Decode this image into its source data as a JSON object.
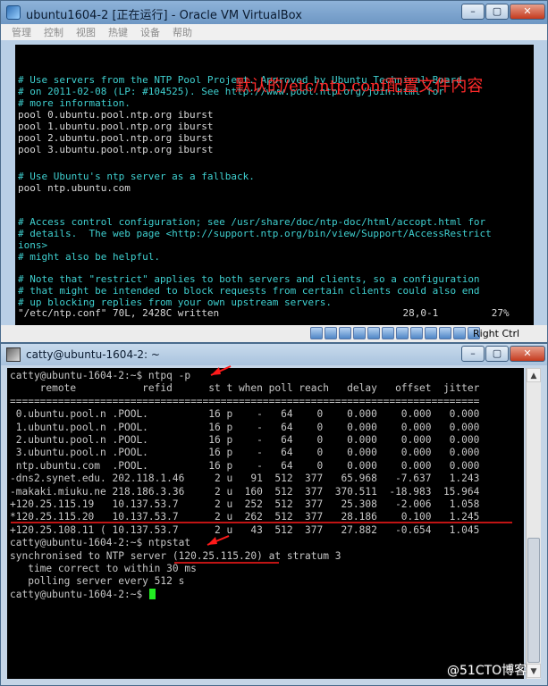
{
  "vbox": {
    "title": "ubuntu1604-2 [正在运行] - Oracle VM VirtualBox",
    "menu": [
      "管理",
      "控制",
      "视图",
      "热键",
      "设备",
      "帮助"
    ],
    "host_key": "Right Ctrl",
    "annotation": "默认的/etc/ntp.conf配置文件内容",
    "terminal_lines": [
      {
        "text": "# Use servers from the NTP Pool Project. Approved by Ubuntu Technical Board",
        "color": "cyan"
      },
      {
        "text": "# on 2011-02-08 (LP: #104525). See http://www.pool.ntp.org/join.html for",
        "color": "cyan"
      },
      {
        "text": "# more information.",
        "color": "cyan"
      },
      {
        "text": "pool 0.ubuntu.pool.ntp.org iburst",
        "color": "white"
      },
      {
        "text": "pool 1.ubuntu.pool.ntp.org iburst",
        "color": "white"
      },
      {
        "text": "pool 2.ubuntu.pool.ntp.org iburst",
        "color": "white"
      },
      {
        "text": "pool 3.ubuntu.pool.ntp.org iburst",
        "color": "white"
      },
      {
        "text": "",
        "color": "white"
      },
      {
        "text": "# Use Ubuntu's ntp server as a fallback.",
        "color": "cyan"
      },
      {
        "text": "pool ntp.ubuntu.com",
        "color": "white"
      },
      {
        "text": "",
        "color": "white"
      },
      {
        "text": "# Access control configuration; see /usr/share/doc/ntp-doc/html/accopt.html for",
        "color": "cyan"
      },
      {
        "text": "# details.  The web page <http://support.ntp.org/bin/view/Support/AccessRestrict",
        "color": "cyan"
      },
      {
        "text": "ions>",
        "color": "cyan"
      },
      {
        "text": "# might also be helpful.",
        "color": "cyan"
      },
      {
        "text": "",
        "color": "white"
      },
      {
        "text": "# Note that \"restrict\" applies to both servers and clients, so a configuration",
        "color": "cyan"
      },
      {
        "text": "# that might be intended to block requests from certain clients could also end",
        "color": "cyan"
      },
      {
        "text": "# up blocking replies from your own upstream servers.",
        "color": "cyan"
      },
      {
        "text": "\"/etc/ntp.conf\" 70L, 2428C written                               28,0-1         27%",
        "color": "white"
      }
    ]
  },
  "putty": {
    "title": "catty@ubuntu-1604-2: ~",
    "lines": [
      "catty@ubuntu-1604-2:~$ ntpq -p",
      "     remote           refid      st t when poll reach   delay   offset  jitter",
      "==============================================================================",
      " 0.ubuntu.pool.n .POOL.          16 p    -   64    0    0.000    0.000   0.000",
      " 1.ubuntu.pool.n .POOL.          16 p    -   64    0    0.000    0.000   0.000",
      " 2.ubuntu.pool.n .POOL.          16 p    -   64    0    0.000    0.000   0.000",
      " 3.ubuntu.pool.n .POOL.          16 p    -   64    0    0.000    0.000   0.000",
      " ntp.ubuntu.com  .POOL.          16 p    -   64    0    0.000    0.000   0.000",
      "-dns2.synet.edu. 202.118.1.46     2 u   91  512  377   65.968   -7.637   1.243",
      "-makaki.miuku.ne 218.186.3.36     2 u  160  512  377  370.511  -18.983  15.964",
      "+120.25.115.19   10.137.53.7      2 u  252  512  377   25.308   -2.006   1.058",
      "*120.25.115.20   10.137.53.7      2 u  262  512  377   28.186    0.100   1.245",
      "+120.25.108.11 ( 10.137.53.7      2 u   43  512  377   27.882   -0.654   1.045",
      "catty@ubuntu-1604-2:~$ ntpstat",
      "synchronised to NTP server (120.25.115.20) at stratum 3",
      "   time correct to within 30 ms",
      "   polling server every 512 s",
      "catty@ubuntu-1604-2:~$ "
    ]
  },
  "watermark": "@51CTO博客"
}
